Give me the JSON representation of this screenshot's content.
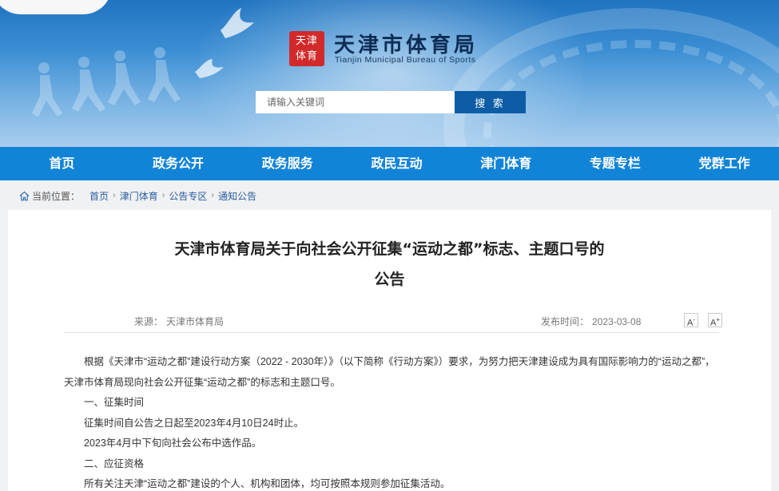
{
  "header": {
    "seal_text": "天津体育",
    "title": "天津市体育局",
    "subtitle": "Tianjin Municipal Bureau of Sports",
    "search_placeholder": "请输入关键词",
    "search_button": "搜 索"
  },
  "nav": [
    "首页",
    "政务公开",
    "政务服务",
    "政民互动",
    "津门体育",
    "专题专栏",
    "党群工作"
  ],
  "breadcrumb": {
    "label": "当前位置：",
    "items": [
      "首页",
      "津门体育",
      "公告专区",
      "通知公告"
    ],
    "separator": "›"
  },
  "article": {
    "title_line1": "天津市体育局关于向社会公开征集“运动之都”标志、主题口号的",
    "title_line2": "公告",
    "source_label": "来源：",
    "source": "天津市体育局",
    "date_label": "发布时间：",
    "date": "2023-03-08",
    "font_decrease": "A",
    "font_increase": "A",
    "paragraphs": [
      "根据《天津市“运动之都”建设行动方案（2022 - 2030年）》（以下简称《行动方案》）要求，为努力把天津建设成为具有国际影响力的“运动之都”，天津市体育局现向社会公开征集“运动之都”的标志和主题口号。",
      "一、征集时间",
      "征集时间自公告之日起至2023年4月10日24时止。",
      "2023年4月中下旬向社会公布中选作品。",
      "二、应征资格",
      "所有关注天津“运动之都”建设的个人、机构和团体，均可按照本规则参加征集活动。"
    ]
  },
  "colors": {
    "nav_bg": "#1284d8",
    "search_button_bg": "#0c5da6",
    "seal_red": "#d22a2a"
  }
}
